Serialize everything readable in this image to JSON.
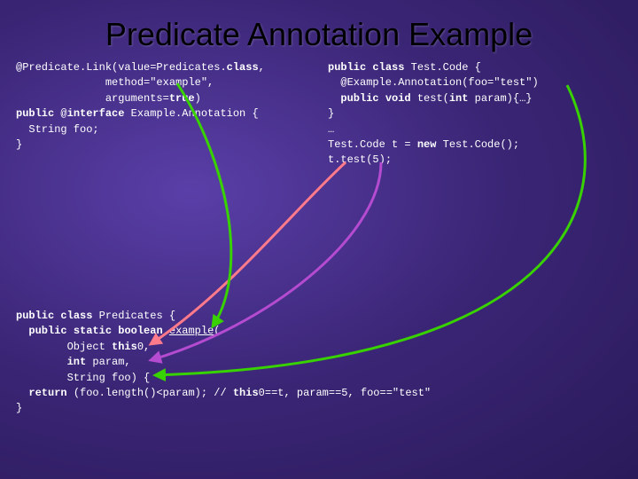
{
  "title": "Predicate Annotation Example",
  "left": {
    "l1a": "@Predicate.Link(value=Predicates.",
    "l1b": "class",
    "l1c": ",",
    "l2a": "              method=",
    "l2b": "\"example\"",
    "l2c": ",",
    "l3a": "              arguments=",
    "l3b": "true",
    "l3c": ")",
    "l4a": "public",
    "l4b": " @",
    "l4c": "interface",
    "l4d": " Example.Annotation {",
    "l5": "  String foo;",
    "l6": "}"
  },
  "right": {
    "r1a": "public",
    "r1b": " ",
    "r1c": "class",
    "r1d": " Test.Code {",
    "r2a": "  @Example.Annotation(foo=",
    "r2b": "\"test\"",
    "r2c": ")",
    "r3a": "  ",
    "r3b": "public",
    "r3c": " ",
    "r3d": "void",
    "r3e": " test(",
    "r3f": "int",
    "r3g": " param){…}",
    "r4": "}",
    "r5": "…",
    "r6a": "Test.Code t = ",
    "r6b": "new",
    "r6c": " Test.Code();",
    "r7a": "t.test(",
    "r7b": "5",
    "r7c": ");"
  },
  "bottom": {
    "b1a": "public",
    "b1b": " ",
    "b1c": "class",
    "b1d": " Predicates {",
    "b2a": "  ",
    "b2b": "public",
    "b2c": " ",
    "b2d": "static",
    "b2e": " ",
    "b2f": "boolean",
    "b2g": " ",
    "b2h": "example",
    "b2i": "(",
    "b3a": "        Object ",
    "b3b": "this",
    "b3c": "0,",
    "b4a": "        ",
    "b4b": "int",
    "b4c": " param,",
    "b5": "        String foo) {",
    "b6a": "  ",
    "b6b": "return",
    "b6c": " (foo.length()<param); // ",
    "b6d": "this",
    "b6e": "0==t, param==",
    "b6f": "5",
    "b6g": ", foo==",
    "b6h": "\"test\"",
    "b7": "}"
  }
}
